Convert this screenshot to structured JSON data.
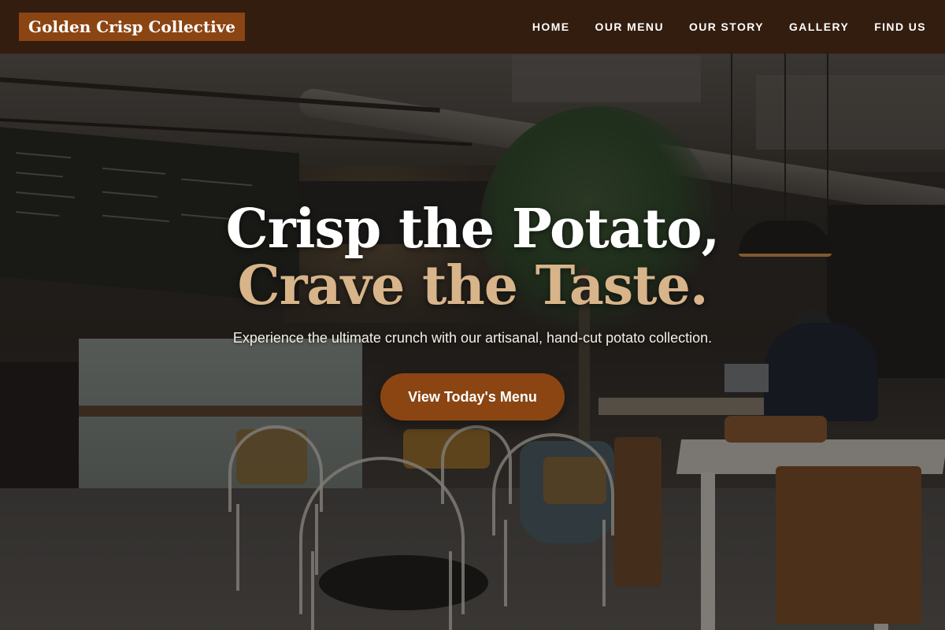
{
  "site": {
    "brand": "Golden Crisp Collective"
  },
  "nav": {
    "items": [
      {
        "label": "HOME"
      },
      {
        "label": "OUR MENU"
      },
      {
        "label": "OUR STORY"
      },
      {
        "label": "GALLERY"
      },
      {
        "label": "FIND US"
      }
    ]
  },
  "hero": {
    "headline_line1": "Crisp the Potato,",
    "headline_line2": "Crave the Taste.",
    "tagline": "Experience the ultimate crunch with our artisanal, hand-cut potato collection.",
    "cta_label": "View Today's Menu",
    "background": "cafe-interior-photo"
  },
  "colors": {
    "header_bg": "#341d0e",
    "brand_accent": "#8b4513",
    "headline_accent": "#d8b48a",
    "text_light": "#ffffff"
  }
}
